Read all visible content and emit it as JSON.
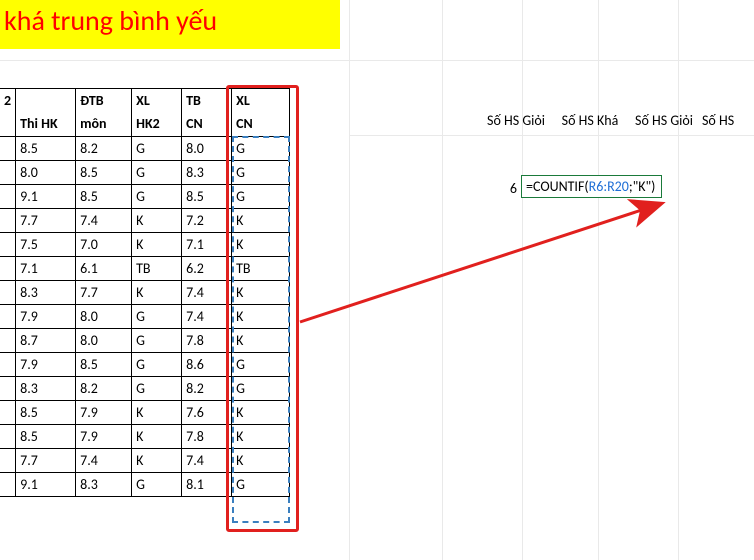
{
  "title": "khá trung bình yếu",
  "headers": {
    "row1": [
      "2",
      "",
      "ĐTB",
      "XL",
      "TB",
      "XL"
    ],
    "row2": [
      "",
      "Thi HK",
      "môn",
      "HK2",
      "CN",
      "CN"
    ]
  },
  "rows": [
    [
      "",
      "8.5",
      "8.2",
      "G",
      "8.0",
      "G"
    ],
    [
      "",
      "8.0",
      "8.5",
      "G",
      "8.3",
      "G"
    ],
    [
      "",
      "9.1",
      "8.5",
      "G",
      "8.5",
      "G"
    ],
    [
      "",
      "7.7",
      "7.4",
      "K",
      "7.2",
      "K"
    ],
    [
      "",
      "7.5",
      "7.0",
      "K",
      "7.1",
      "K"
    ],
    [
      "",
      "7.1",
      "6.1",
      "TB",
      "6.2",
      "TB"
    ],
    [
      "",
      "8.3",
      "7.7",
      "K",
      "7.4",
      "K"
    ],
    [
      "",
      "7.9",
      "8.0",
      "G",
      "7.4",
      "K"
    ],
    [
      "",
      "8.7",
      "8.0",
      "G",
      "7.8",
      "K"
    ],
    [
      "",
      "7.9",
      "8.5",
      "G",
      "8.6",
      "G"
    ],
    [
      "",
      "8.3",
      "8.2",
      "G",
      "8.2",
      "G"
    ],
    [
      "",
      "8.5",
      "7.9",
      "K",
      "7.6",
      "K"
    ],
    [
      "",
      "8.5",
      "7.9",
      "K",
      "7.8",
      "K"
    ],
    [
      "",
      "7.7",
      "7.4",
      "K",
      "7.4",
      "K"
    ],
    [
      "",
      "9.1",
      "8.3",
      "G",
      "8.1",
      "G"
    ]
  ],
  "side_labels": [
    "Số HS Giỏi",
    "Số HS Khá",
    "Số HS Giỏi",
    "Số HS"
  ],
  "result_value": "6",
  "formula": {
    "prefix": "=COUNTIF(",
    "ref": "R6:R20",
    "suffix": ";\"K\")"
  },
  "chart_data": {
    "type": "table",
    "columns": [
      "Thi HK",
      "ĐTB môn",
      "XL HK2",
      "TB CN",
      "XL CN"
    ],
    "data": [
      [
        8.5,
        8.2,
        "G",
        8.0,
        "G"
      ],
      [
        8.0,
        8.5,
        "G",
        8.3,
        "G"
      ],
      [
        9.1,
        8.5,
        "G",
        8.5,
        "G"
      ],
      [
        7.7,
        7.4,
        "K",
        7.2,
        "K"
      ],
      [
        7.5,
        7.0,
        "K",
        7.1,
        "K"
      ],
      [
        7.1,
        6.1,
        "TB",
        6.2,
        "TB"
      ],
      [
        8.3,
        7.7,
        "K",
        7.4,
        "K"
      ],
      [
        7.9,
        8.0,
        "G",
        7.4,
        "K"
      ],
      [
        8.7,
        8.0,
        "G",
        7.8,
        "K"
      ],
      [
        7.9,
        8.5,
        "G",
        8.6,
        "G"
      ],
      [
        8.3,
        8.2,
        "G",
        8.2,
        "G"
      ],
      [
        8.5,
        7.9,
        "K",
        7.6,
        "K"
      ],
      [
        8.5,
        7.9,
        "K",
        7.8,
        "K"
      ],
      [
        7.7,
        7.4,
        "K",
        7.4,
        "K"
      ],
      [
        9.1,
        8.3,
        "G",
        8.1,
        "G"
      ]
    ],
    "formula_shown": "=COUNTIF(R6:R20;\"K\")",
    "formula_result": 6
  }
}
